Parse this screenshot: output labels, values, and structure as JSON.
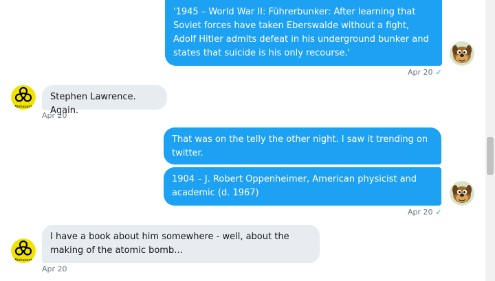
{
  "messages": [
    {
      "text": "'1945 – World War II: Führerbunker: After learning that Soviet forces have taken Eberswalde without a fight, Adolf Hitler admits defeat in his underground bunker and states that suicide is his only recourse.'"
    },
    {
      "text": "Stephen Lawrence. Again."
    },
    {
      "text": "That was on the telly the other night. I saw it trending on twitter."
    },
    {
      "text": "1904 – J. Robert Oppenheimer, American physicist and academic (d. 1967)"
    },
    {
      "text": "I have a book about him somewhere - well, about the making of the atomic bomb..."
    }
  ],
  "timestamps": {
    "sent_1": "Apr 20",
    "recv_1": "Apr 20",
    "sent_2": "Apr 20",
    "recv_2": "Apr 20"
  },
  "status_icon": "✓",
  "avatar_labels": {
    "other_user": "Biohazard"
  },
  "colors": {
    "sent_bubble": "#1da1f2",
    "received_bubble": "#e6ecf0"
  }
}
